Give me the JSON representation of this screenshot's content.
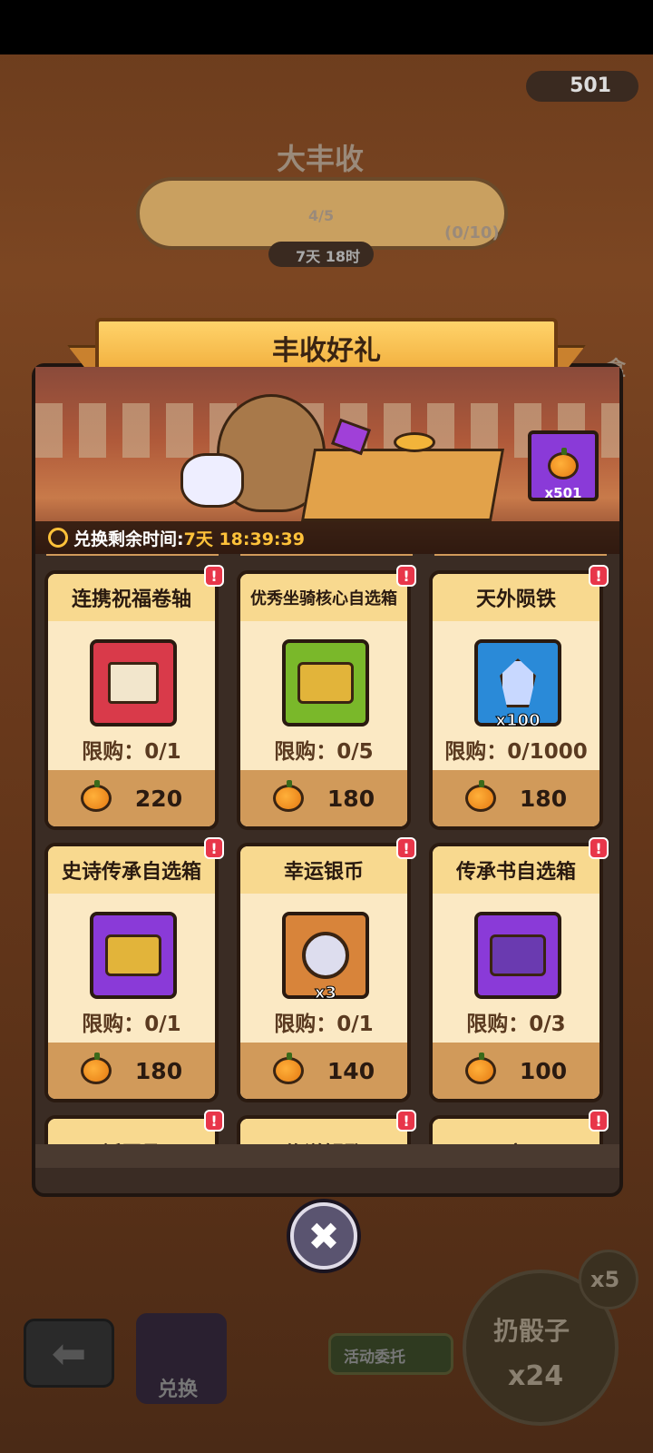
{
  "hud": {
    "currency_count": "501"
  },
  "event": {
    "title": "大丰收",
    "progress_text": "4/5",
    "reward_count": "(0/10)",
    "time_left": "7天 18时"
  },
  "side": {
    "box_label": "盒"
  },
  "modal": {
    "title": "丰收好礼",
    "timer_label": "兑换剩余时间:",
    "timer_value": "7天 18:39:39",
    "pumpkin_badge": "x501",
    "badge_mark": "!"
  },
  "cards": [
    {
      "title": "连携祝福卷轴",
      "limit": "限购：0/1",
      "price": "220",
      "qty": "",
      "icon": "scroll-icon",
      "color": "#d93a4a"
    },
    {
      "title": "优秀坐骑核心自选箱",
      "limit": "限购：0/5",
      "price": "180",
      "qty": "",
      "icon": "chest-icon",
      "color": "#7ab82a"
    },
    {
      "title": "天外陨铁",
      "limit": "限购：0/1000",
      "price": "180",
      "qty": "x100",
      "icon": "crystal-icon",
      "color": "#2a8ad8"
    },
    {
      "title": "史诗传承自选箱",
      "limit": "限购：0/1",
      "price": "180",
      "qty": "",
      "icon": "chest-icon",
      "color": "#8a3ad8"
    },
    {
      "title": "幸运银币",
      "limit": "限购：0/1",
      "price": "140",
      "qty": "x3",
      "icon": "coin-icon",
      "color": "#d8843a"
    },
    {
      "title": "传承书自选箱",
      "limit": "限购：0/3",
      "price": "100",
      "qty": "",
      "icon": "chest-icon",
      "color": "#8a3ad8"
    },
    {
      "title": "祈愿函",
      "limit": "",
      "price": "",
      "qty": "",
      "icon": "",
      "color": ""
    },
    {
      "title": "传说钥匙",
      "limit": "",
      "price": "",
      "qty": "",
      "icon": "",
      "color": ""
    },
    {
      "title": "不变石",
      "limit": "",
      "price": "",
      "qty": "",
      "icon": "",
      "color": ""
    }
  ],
  "footer": {
    "exchange_label": "兑换",
    "commission_label": "活动委托",
    "dice_label": "扔骰子",
    "dice_count": "x24",
    "multiplier": "x5"
  }
}
